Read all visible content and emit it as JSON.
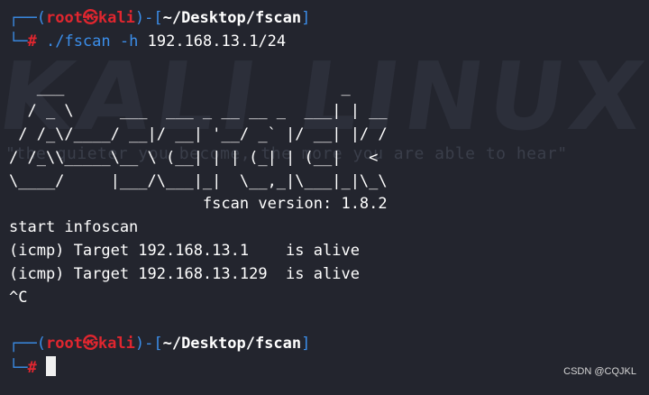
{
  "prompt1": {
    "corner_top": "┌──",
    "open_paren": "(",
    "user": "root",
    "at": "㉿",
    "host": "kali",
    "close_paren": ")-[",
    "path": "~/Desktop/fscan",
    "close_bracket": "]",
    "corner_bottom": "└─",
    "hash": "#",
    "cmd": "./fscan",
    "flag": "-h",
    "args": "192.168.13.1/24"
  },
  "ascii_art": [
    "   ___                              _    ",
    "  / _ \\     ___  ___ _ __ __ _  ___| | __ ",
    " / /_\\/____/ __|/ __| '__/ _` |/ __| |/ /",
    "/ /_\\\\_____\\__ \\ (__| | | (_| | (__|   <    ",
    "\\____/     |___/\\___|_|  \\__,_|\\___|_|\\_\\   "
  ],
  "version_line": "                     fscan version: 1.8.2",
  "output": [
    "start infoscan",
    "(icmp) Target 192.168.13.1    is alive",
    "(icmp) Target 192.168.13.129  is alive",
    "^C"
  ],
  "prompt2": {
    "corner_top": "┌──",
    "open_paren": "(",
    "user": "root",
    "at": "㉿",
    "host": "kali",
    "close_paren": ")-[",
    "path": "~/Desktop/fscan",
    "close_bracket": "]",
    "corner_bottom": "└─",
    "hash": "#"
  },
  "watermark": "CSDN @CQJKL",
  "colors": {
    "background": "#23252e",
    "prompt_blue": "#3b8eea",
    "prompt_red": "#e0262f",
    "text": "#ffffff"
  }
}
